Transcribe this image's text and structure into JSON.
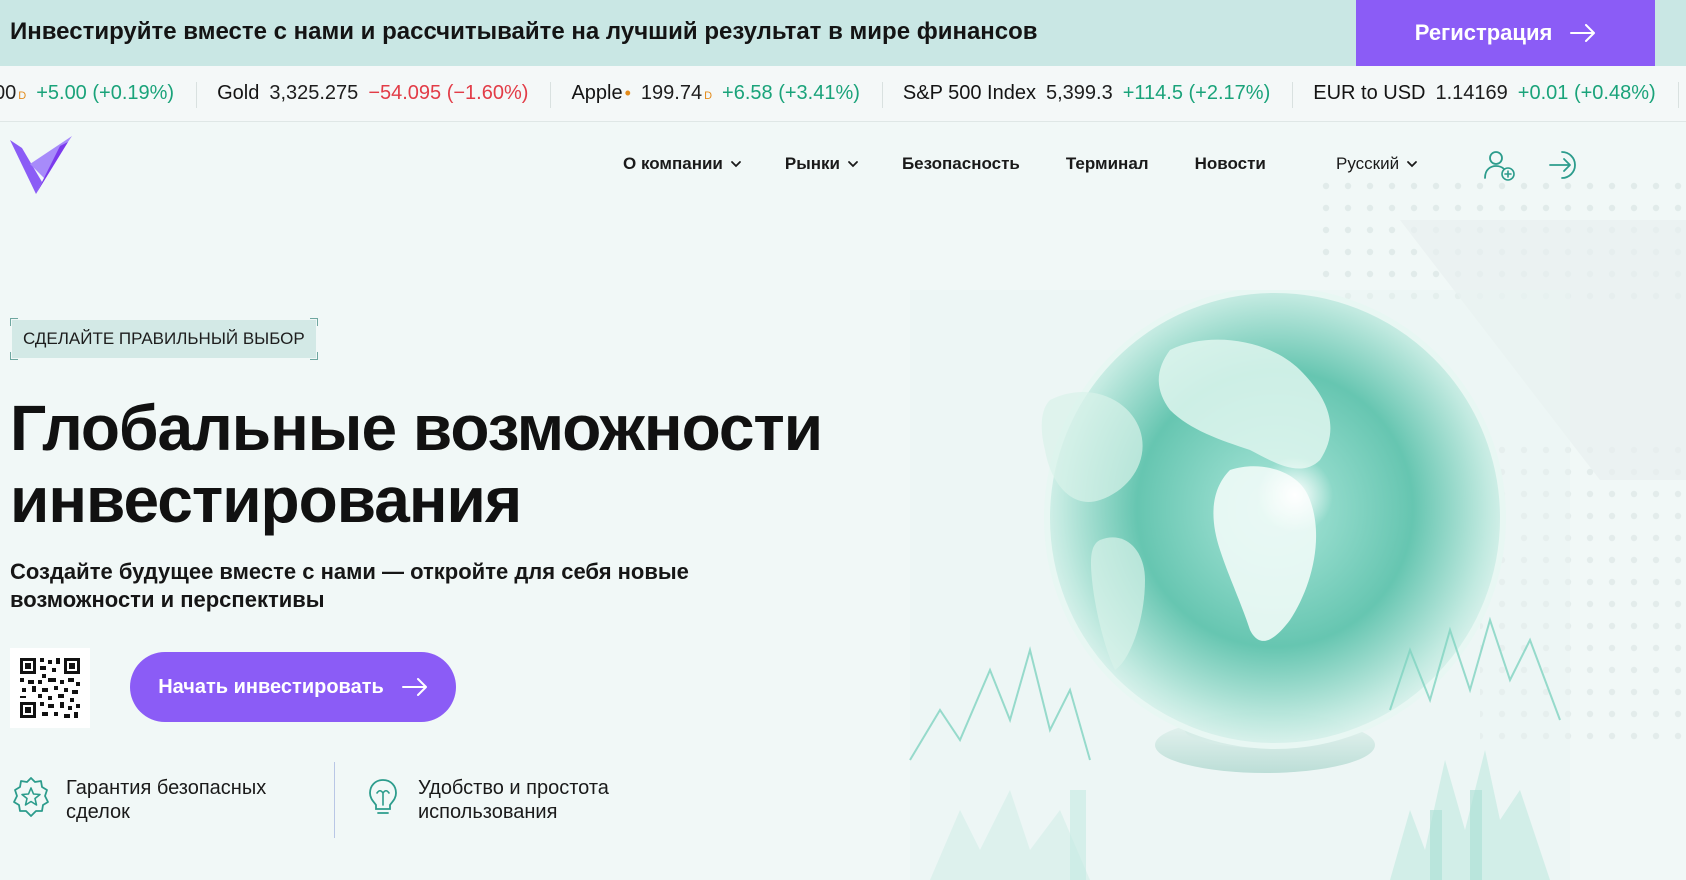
{
  "banner": {
    "text": "Инвестируйте вместе с нами и рассчитывайте на лучший результат в мире финансов",
    "register_label": "Регистрация"
  },
  "ticker": [
    {
      "name": "",
      "price": "00",
      "sup": "D",
      "change": "+5.00 (+0.19%)",
      "direction": "up"
    },
    {
      "name": "Gold",
      "price": "3,325.275",
      "sup": "",
      "change": "−54.095 (−1.60%)",
      "direction": "down"
    },
    {
      "name": "Apple",
      "dot": "•",
      "price": "199.74",
      "sup": "D",
      "change": "+6.58 (+3.41%)",
      "direction": "up"
    },
    {
      "name": "S&P 500 Index",
      "price": "5,399.3",
      "sup": "",
      "change": "+114.5 (+2.17%)",
      "direction": "up"
    },
    {
      "name": "EUR to USD",
      "price": "1.14169",
      "sup": "",
      "change": "+0.01 (+0.48%)",
      "direction": "up"
    }
  ],
  "nav": {
    "items": [
      {
        "label": "О компании",
        "dropdown": true
      },
      {
        "label": "Рынки",
        "dropdown": true
      },
      {
        "label": "Безопасность",
        "dropdown": false
      },
      {
        "label": "Терминал",
        "dropdown": false
      },
      {
        "label": "Новости",
        "dropdown": false
      }
    ],
    "language": "Русский"
  },
  "hero": {
    "tagline": "СДЕЛАЙТЕ ПРАВИЛЬНЫЙ ВЫБОР",
    "title_line1": "Глобальные возможности",
    "title_line2": "инвестирования",
    "subtitle_line1": "Создайте будущее вместе с нами — откройте для себя новые",
    "subtitle_line2": "возможности и перспективы",
    "cta_label": "Начать инвестировать"
  },
  "features": [
    {
      "line1": "Гарантия безопасных",
      "line2": "сделок",
      "icon": "shield-star-icon"
    },
    {
      "line1": "Удобство и простота",
      "line2": "использования",
      "icon": "bulb-icon"
    }
  ],
  "colors": {
    "accent": "#8b5cf6",
    "banner_bg": "#c9e7e4",
    "page_bg": "#f1f8f7",
    "positive": "#1aa37a",
    "negative": "#e23c47",
    "teal": "#2c9c8c"
  }
}
